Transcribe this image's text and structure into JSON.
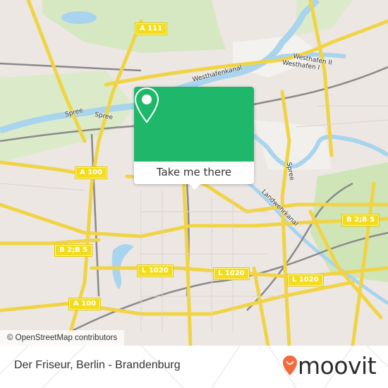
{
  "map": {
    "attribution": "© OpenStreetMap contributors",
    "road_shields": [
      {
        "id": "a111",
        "label": "A 111"
      },
      {
        "id": "a100-north",
        "label": "A 100"
      },
      {
        "id": "a100-south",
        "label": "A 100"
      },
      {
        "id": "b2b5-west",
        "label": "B 2;B 5"
      },
      {
        "id": "b2b5-east",
        "label": "B 2;B 5"
      },
      {
        "id": "l1020-west",
        "label": "L 1020"
      },
      {
        "id": "l1020-center",
        "label": "L 1020"
      },
      {
        "id": "l1020-east",
        "label": "L 1020"
      }
    ],
    "labels": {
      "westhafenkanal": "Westhafenkanal",
      "westhafen2": "Westhafen II",
      "westhafen1": "Westhafen I",
      "spree1": "Spree",
      "spree2": "Spree",
      "spree3": "Spree",
      "landwehrkanal": "Landwehrkanal"
    },
    "colors": {
      "land": "#ece7e3",
      "park": "#d5e8c2",
      "water": "#a9d4ee",
      "road": "#f7df5a",
      "rail": "#8a8a8a"
    }
  },
  "popup": {
    "button_label": "Take me there",
    "accent": "#1fb86a",
    "icon": "map-pin-icon"
  },
  "footer": {
    "title": "Der Friseur, Berlin - Brandenburg",
    "brand": "moovit",
    "brand_color": "#f26a3d"
  }
}
